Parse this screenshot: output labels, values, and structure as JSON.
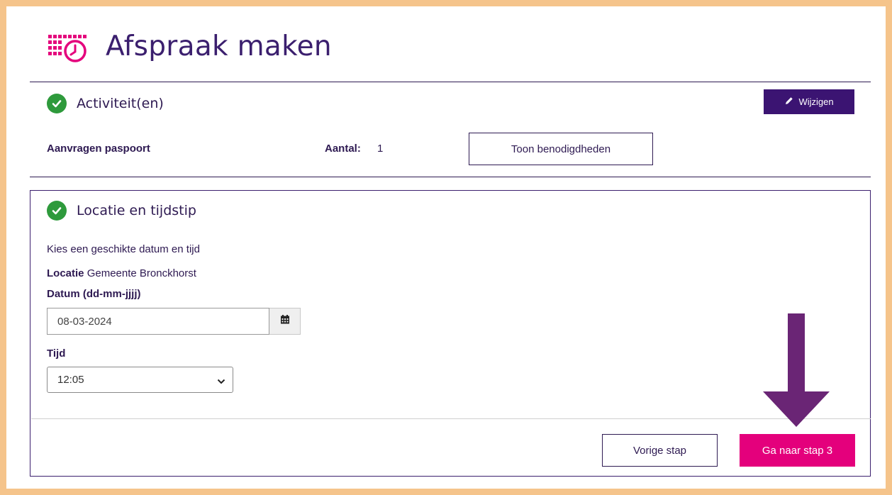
{
  "header": {
    "title": "Afspraak maken",
    "logo_icon": "calendar-clock-icon"
  },
  "colors": {
    "accent": "#e4007c",
    "primary": "#3b1472",
    "success": "#2e9a3c",
    "frame": "#f5c48b",
    "annotation_arrow": "#6a2575"
  },
  "activities": {
    "title": "Activiteit(en)",
    "edit_label": "Wijzigen",
    "items": [
      {
        "name": "Aanvragen paspoort",
        "count_label": "Aantal:",
        "count": "1",
        "requirements_label": "Toon benodigdheden"
      }
    ]
  },
  "location_time": {
    "title": "Locatie en tijdstip",
    "instruction": "Kies een geschikte datum en tijd",
    "location_label": "Locatie",
    "location_value": "Gemeente Bronckhorst",
    "date_label": "Datum (dd-mm-jjjj)",
    "date_value": "08-03-2024",
    "time_label": "Tijd",
    "time_value": "12:05"
  },
  "footer": {
    "prev_label": "Vorige stap",
    "next_label": "Ga naar stap 3"
  }
}
